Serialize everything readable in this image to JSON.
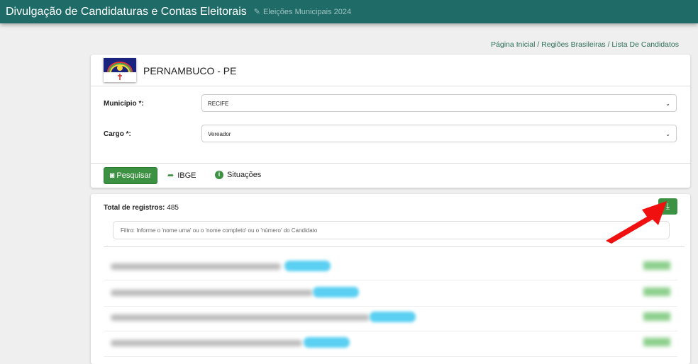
{
  "header": {
    "title": "Divulgação de Candidaturas e Contas Eleitorais",
    "subtitle": "Eleições Municipais 2024"
  },
  "breadcrumb": "Página Inicial / Regiões Brasileiras / Lista De Candidatos",
  "state": "PERNAMBUCO - PE",
  "form": {
    "municipio_label": "Município *:",
    "municipio_value": "RECIFE",
    "cargo_label": "Cargo *:",
    "cargo_value": "Vereador"
  },
  "actions": {
    "search": "Pesquisar",
    "ibge": "IBGE",
    "situacoes": "Situações"
  },
  "results": {
    "total_label": "Total de registros:",
    "total": "485",
    "filter_placeholder": "Filtro: Informe o 'nome urna' ou o 'nome completo' ou o 'número' do Candidato"
  }
}
